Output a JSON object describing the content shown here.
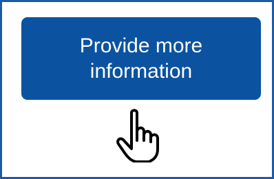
{
  "panel": {
    "border_color": "#1d5aa8"
  },
  "cta_button": {
    "label": "Provide more information",
    "background_color": "#0b53a0",
    "text_color": "#ffffff"
  },
  "cursor": {
    "icon": "hand-pointer-icon",
    "stroke_color": "#000000"
  }
}
